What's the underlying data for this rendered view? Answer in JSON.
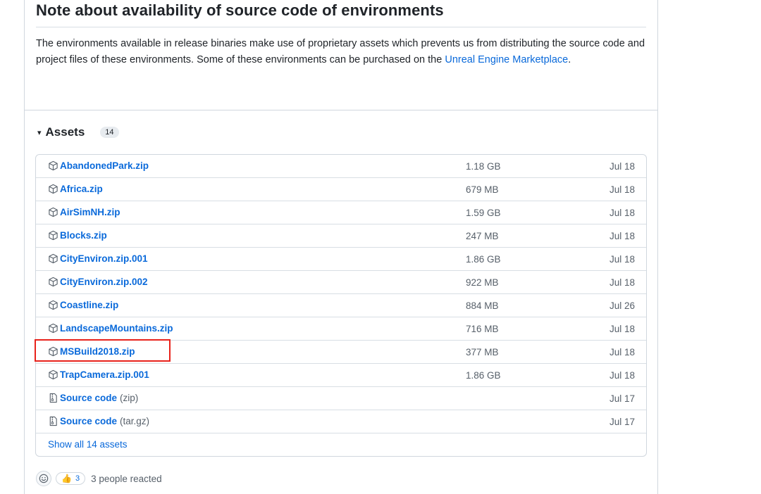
{
  "note": {
    "title": "Note about availability of source code of environments",
    "body_prefix": "The environments available in release binaries make use of proprietary assets which prevents us from distributing the source code and project files of these environments. Some of these environments can be purchased on the ",
    "link_text": "Unreal Engine Marketplace",
    "body_suffix": "."
  },
  "assets": {
    "caret": "▾",
    "title": "Assets",
    "count": "14",
    "rows": [
      {
        "name": "AbandonedPark.zip",
        "size": "1.18 GB",
        "date": "Jul 18",
        "icon": "package-icon"
      },
      {
        "name": "Africa.zip",
        "size": "679 MB",
        "date": "Jul 18",
        "icon": "package-icon"
      },
      {
        "name": "AirSimNH.zip",
        "size": "1.59 GB",
        "date": "Jul 18",
        "icon": "package-icon"
      },
      {
        "name": "Blocks.zip",
        "size": "247 MB",
        "date": "Jul 18",
        "icon": "package-icon"
      },
      {
        "name": "CityEnviron.zip.001",
        "size": "1.86 GB",
        "date": "Jul 18",
        "icon": "package-icon"
      },
      {
        "name": "CityEnviron.zip.002",
        "size": "922 MB",
        "date": "Jul 18",
        "icon": "package-icon"
      },
      {
        "name": "Coastline.zip",
        "size": "884 MB",
        "date": "Jul 26",
        "icon": "package-icon"
      },
      {
        "name": "LandscapeMountains.zip",
        "size": "716 MB",
        "date": "Jul 18",
        "icon": "package-icon"
      },
      {
        "name": "MSBuild2018.zip",
        "size": "377 MB",
        "date": "Jul 18",
        "icon": "package-icon"
      },
      {
        "name": "TrapCamera.zip.001",
        "size": "1.86 GB",
        "date": "Jul 18",
        "icon": "package-icon"
      }
    ],
    "source_rows": [
      {
        "name": "Source code",
        "suffix": "(zip)",
        "date": "Jul 17",
        "icon": "file-zip-icon"
      },
      {
        "name": "Source code",
        "suffix": "(tar.gz)",
        "date": "Jul 17",
        "icon": "file-zip-icon"
      }
    ],
    "show_all": "Show all 14 assets"
  },
  "reactions": {
    "emoji": "👍",
    "count": "3",
    "summary": "3 people reacted"
  },
  "colors": {
    "link": "#0969da",
    "highlight": "#e8221b",
    "muted": "#57606a",
    "border": "#d0d7de"
  }
}
